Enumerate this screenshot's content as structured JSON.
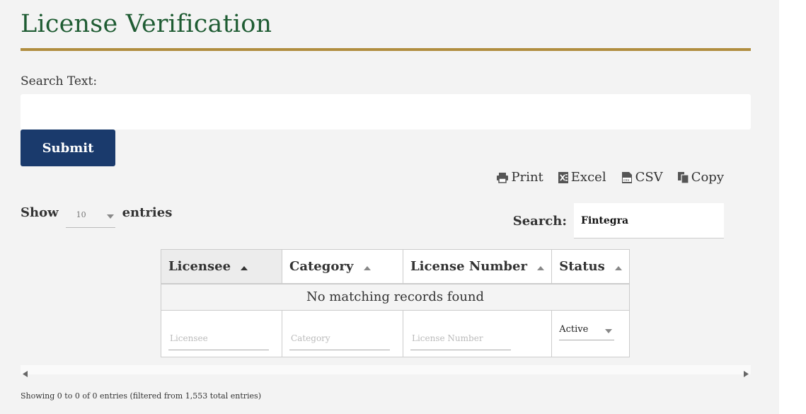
{
  "page_title": "License Verification",
  "search_form": {
    "label": "Search Text:",
    "value": "",
    "submit_label": "Submit"
  },
  "export_buttons": [
    {
      "label": "Print",
      "icon": "printer-icon"
    },
    {
      "label": "Excel",
      "icon": "excel-icon"
    },
    {
      "label": "CSV",
      "icon": "csv-icon"
    },
    {
      "label": "Copy",
      "icon": "copy-icon"
    }
  ],
  "length_menu": {
    "show_label": "Show",
    "selected": "10",
    "entries_label": "entries"
  },
  "table_search": {
    "label": "Search:",
    "value": "Fintegra"
  },
  "table": {
    "columns": [
      {
        "label": "Licensee",
        "filter_placeholder": "Licensee"
      },
      {
        "label": "Category",
        "filter_placeholder": "Category"
      },
      {
        "label": "License Number",
        "filter_placeholder": "License Number"
      },
      {
        "label": "Status",
        "filter_selected": "Active"
      }
    ],
    "empty_message": "No matching records found"
  },
  "info": "Showing 0 to 0 of 0 entries (filtered from 1,553 total entries)",
  "colors": {
    "title": "#1f5c33",
    "rule": "#b08d3f",
    "button": "#1a3a6c"
  }
}
